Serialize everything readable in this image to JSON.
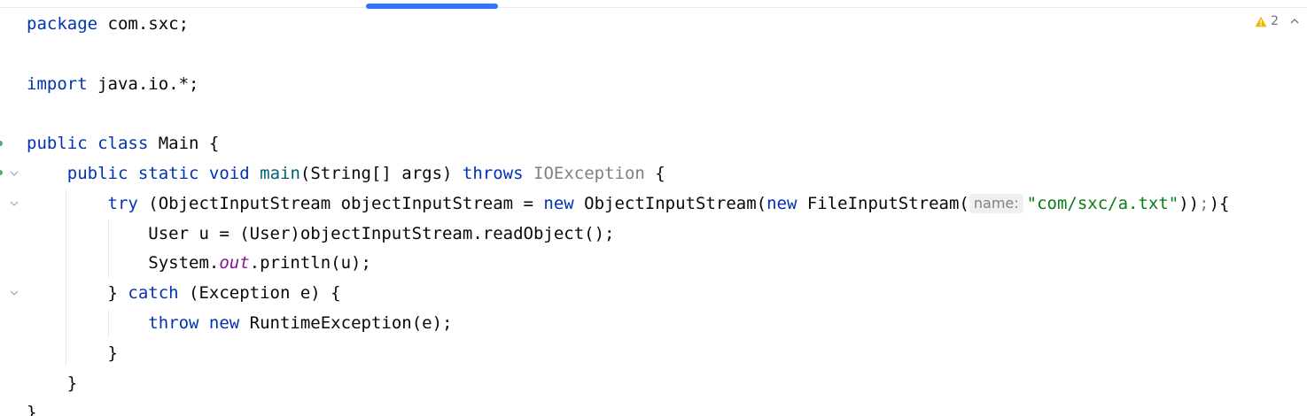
{
  "editor": {
    "warnings": {
      "count": "2"
    },
    "lines": [
      [
        {
          "t": "package",
          "c": "kw"
        },
        {
          "t": " com.sxc;"
        }
      ],
      [],
      [
        {
          "t": "import",
          "c": "kw"
        },
        {
          "t": " java.io.*;"
        }
      ],
      [],
      [
        {
          "t": "public class",
          "c": "kw"
        },
        {
          "t": " Main {"
        }
      ],
      [
        {
          "t": "    "
        },
        {
          "t": "public static void",
          "c": "kw"
        },
        {
          "t": " "
        },
        {
          "t": "main",
          "c": "fn"
        },
        {
          "t": "(String[] args) "
        },
        {
          "t": "throws",
          "c": "kw"
        },
        {
          "t": " "
        },
        {
          "t": "IOException",
          "c": "unused"
        },
        {
          "t": " {"
        }
      ],
      [
        {
          "t": "        "
        },
        {
          "t": "try",
          "c": "kw"
        },
        {
          "t": " (ObjectInputStream objectInputStream = "
        },
        {
          "t": "new",
          "c": "kw"
        },
        {
          "t": " ObjectInputStream("
        },
        {
          "t": "new",
          "c": "kw"
        },
        {
          "t": " FileInputStream("
        },
        {
          "t": "name:",
          "c": "hint"
        },
        {
          "t": "\"com/sxc/a.txt\"",
          "c": "str"
        },
        {
          "t": "))"
        },
        {
          "t": ";",
          "c": "semi-warn"
        },
        {
          "t": "){"
        }
      ],
      [
        {
          "t": "            User u = (User)objectInputStream.readObject();"
        }
      ],
      [
        {
          "t": "            System."
        },
        {
          "t": "out",
          "c": "field"
        },
        {
          "t": ".println(u);"
        }
      ],
      [
        {
          "t": "        } "
        },
        {
          "t": "catch",
          "c": "kw"
        },
        {
          "t": " (Exception e) {"
        }
      ],
      [
        {
          "t": "            "
        },
        {
          "t": "throw new",
          "c": "kw"
        },
        {
          "t": " RuntimeException(e);"
        }
      ],
      [
        {
          "t": "        }"
        }
      ],
      [
        {
          "t": "    }"
        }
      ],
      [
        {
          "t": "}"
        }
      ]
    ]
  }
}
